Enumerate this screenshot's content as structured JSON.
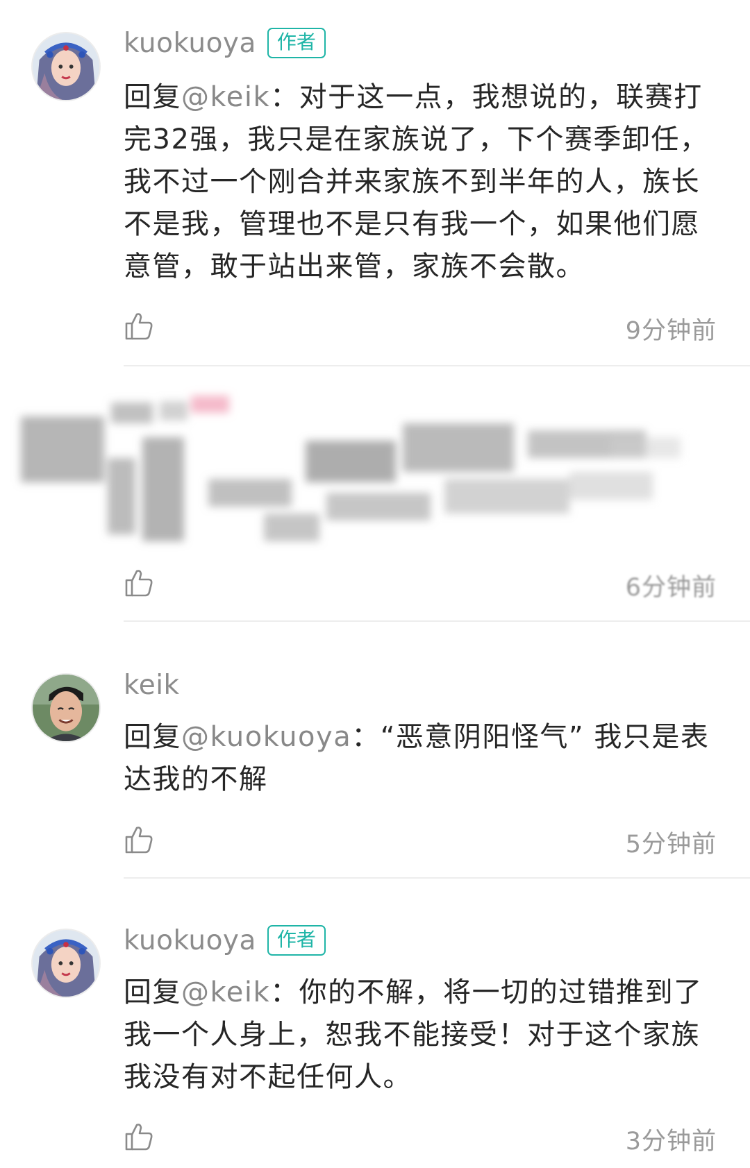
{
  "comments": [
    {
      "username": "kuokuoya",
      "badge": "作者",
      "reply_prefix": "回复",
      "mention": "@keik",
      "text": "：对于这一点，我想说的，联赛打完32强，我只是在家族说了，下个赛季卸任，我不过一个刚合并来家族不到半年的人，族长不是我，管理也不是只有我一个，如果他们愿意管，敢于站出来管，家族不会散。",
      "time": "9分钟前",
      "avatar_icon": "girl-avatar-icon"
    },
    {
      "redacted": true,
      "time": "6分钟前"
    },
    {
      "username": "keik",
      "reply_prefix": "回复",
      "mention": "@kuokuoya",
      "text": "：“恶意阴阳怪气” 我只是表达我的不解",
      "time": "5分钟前",
      "avatar_icon": "man-avatar-icon"
    },
    {
      "username": "kuokuoya",
      "badge": "作者",
      "reply_prefix": "回复",
      "mention": "@keik",
      "text": "：你的不解，将一切的过错推到了我一个人身上，恕我不能接受！对于这个家族我没有对不起任何人。",
      "time": "3分钟前",
      "avatar_icon": "girl-avatar-icon"
    }
  ],
  "colors": {
    "badge": "#1fb5a7",
    "username": "#8c8c8c",
    "mention": "#888888",
    "text": "#262626",
    "timestamp": "#9a9a9a",
    "divider": "#ededed"
  },
  "icons": {
    "like": "thumbs-up-icon"
  }
}
